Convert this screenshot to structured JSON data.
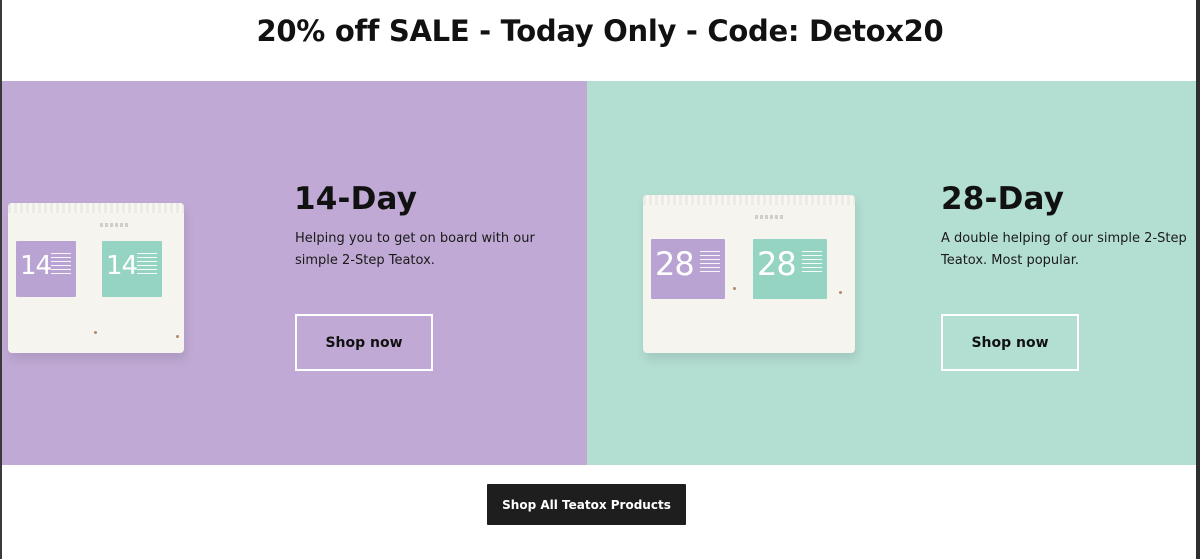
{
  "banner": {
    "text": "20% off SALE - Today Only - Code: Detox20"
  },
  "colors": {
    "purple_panel": "#c0aad5",
    "green_panel": "#b3ded2",
    "label_purple": "#b9a3d3",
    "label_green": "#95d3c3",
    "dark_button": "#1e1e1e"
  },
  "offers": [
    {
      "title": "14-Day",
      "description": "Helping you to get on board with our simple 2-Step Teatox.",
      "button_label": "Shop now",
      "packs": [
        {
          "number": "14",
          "label_color": "#b9a3d3"
        },
        {
          "number": "14",
          "label_color": "#95d3c3"
        }
      ]
    },
    {
      "title": "28-Day",
      "description": "A double helping of our simple 2-Step Teatox. Most popular.",
      "button_label": "Shop now",
      "packs": [
        {
          "number": "28",
          "label_color": "#b9a3d3"
        },
        {
          "number": "28",
          "label_color": "#95d3c3"
        }
      ]
    }
  ],
  "shop_all": {
    "label": "Shop All Teatox Products"
  }
}
